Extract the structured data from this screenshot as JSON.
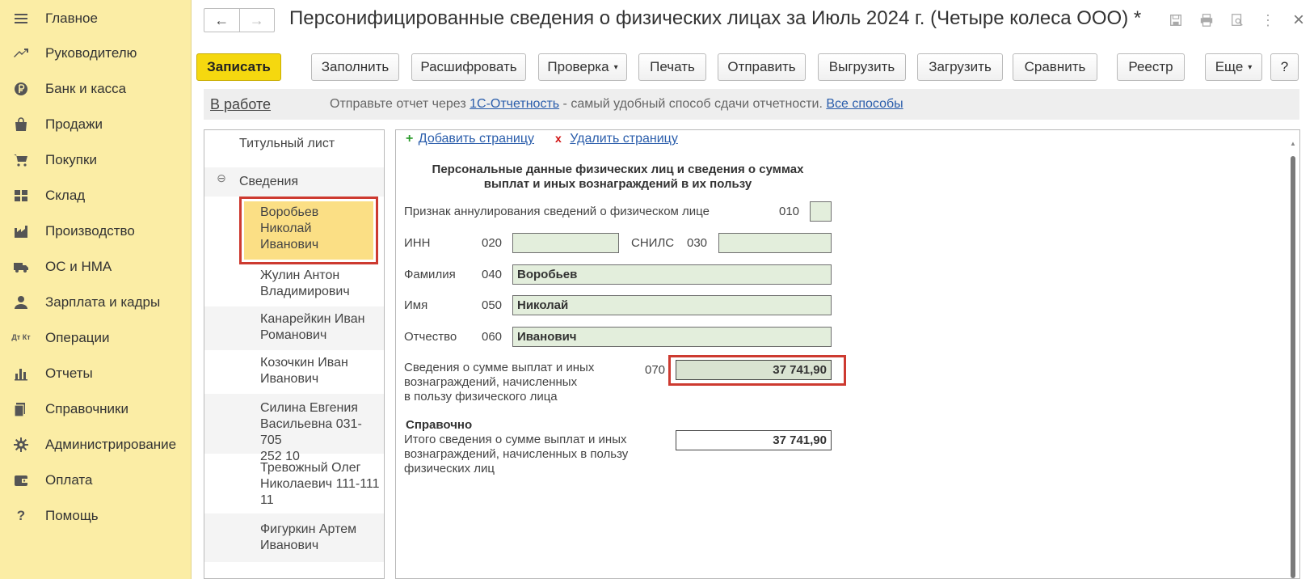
{
  "sidebar": {
    "items": [
      {
        "label": "Главное",
        "icon": "menu-icon"
      },
      {
        "label": "Руководителю",
        "icon": "trend-icon"
      },
      {
        "label": "Банк и касса",
        "icon": "ruble-coin-icon"
      },
      {
        "label": "Продажи",
        "icon": "shopping-bag-icon"
      },
      {
        "label": "Покупки",
        "icon": "cart-icon"
      },
      {
        "label": "Склад",
        "icon": "warehouse-icon"
      },
      {
        "label": "Производство",
        "icon": "factory-icon"
      },
      {
        "label": "ОС и НМА",
        "icon": "truck-icon"
      },
      {
        "label": "Зарплата и кадры",
        "icon": "person-icon"
      },
      {
        "label": "Операции",
        "icon": "dt-kt-icon"
      },
      {
        "label": "Отчеты",
        "icon": "bar-chart-icon"
      },
      {
        "label": "Справочники",
        "icon": "books-icon"
      },
      {
        "label": "Администрирование",
        "icon": "gear-icon"
      },
      {
        "label": "Оплата",
        "icon": "wallet-icon"
      },
      {
        "label": "Помощь",
        "icon": "question-icon"
      }
    ],
    "dt_kt": "Дт Кт",
    "help_glyph": "?"
  },
  "header": {
    "title": "Персонифицированные сведения о физических лицах за Июль 2024 г. (Четыре колеса ООО) *",
    "back": "←",
    "forward": "→",
    "close": "×",
    "more": "⋮"
  },
  "toolbar": {
    "save": "Записать",
    "fill": "Заполнить",
    "decode": "Расшифровать",
    "check": "Проверка",
    "print": "Печать",
    "send": "Отправить",
    "export": "Выгрузить",
    "import": "Загрузить",
    "compare": "Сравнить",
    "registry": "Реестр",
    "more": "Еще",
    "help": "?",
    "caret": "▾"
  },
  "infobar": {
    "status": "В работе",
    "msg_prefix": "Отправьте отчет через ",
    "msg_link": "1С-Отчетность",
    "msg_middle": " - самый удобный способ сдачи отчетности. ",
    "msg_link2": "Все способы"
  },
  "tree": {
    "title_page": "Титульный лист",
    "section": "Сведения",
    "collapse": "⊖",
    "people": [
      {
        "line1": "Воробьев",
        "line2": "Николай",
        "line3": "Иванович"
      },
      {
        "line1": "Жулин Антон",
        "line2": "Владимирович",
        "line3": ""
      },
      {
        "line1": "Канарейкин Иван",
        "line2": "Романович",
        "line3": ""
      },
      {
        "line1": "Козочкин Иван",
        "line2": "Иванович",
        "line3": ""
      },
      {
        "line1": "Силина Евгения",
        "line2": "Васильевна 031-705",
        "line3": "252 10"
      },
      {
        "line1": "Тревожный Олег",
        "line2": "Николаевич 111-111",
        "line3": "11"
      },
      {
        "line1": "Фигуркин Артем",
        "line2": "Иванович",
        "line3": ""
      }
    ]
  },
  "form": {
    "plus": "+",
    "add_page": "Добавить страницу",
    "x": "x",
    "delete_page": "Удалить страницу",
    "heading_line1": "Персональные данные физических лиц и сведения о суммах",
    "heading_line2": "выплат и иных вознаграждений в их пользу",
    "cancel_label": "Признак аннулирования сведений о физическом лице",
    "cancel_code": "010",
    "cancel_value": "",
    "inn_label": "ИНН",
    "inn_code": "020",
    "inn_value": "",
    "snils_label": "СНИЛС",
    "snils_code": "030",
    "snils_value": "",
    "surname_label": "Фамилия",
    "surname_code": "040",
    "surname_value": "Воробьев",
    "name_label": "Имя",
    "name_code": "050",
    "name_value": "Николай",
    "patronymic_label": "Отчество",
    "patronymic_code": "060",
    "patronymic_value": "Иванович",
    "sum_label_1": "Сведения о сумме выплат и иных",
    "sum_label_2": "вознаграждений, начисленных",
    "sum_label_3": "в пользу физического лица",
    "sum_code": "070",
    "sum_value": "37 741,90",
    "ref_title": "Справочно",
    "total_label_1": "Итого сведения о сумме выплат и иных",
    "total_label_2": "вознаграждений, начисленных в пользу",
    "total_label_3": "физических лиц",
    "total_value": "37 741,90"
  },
  "colors": {
    "sidebar_bg": "#fbeda5",
    "primary_button": "#f5d80f",
    "highlight_red": "#cd3a30",
    "field_green": "#e3eedc",
    "selected_row": "#fbdf85",
    "link_blue": "#2a5dab"
  }
}
